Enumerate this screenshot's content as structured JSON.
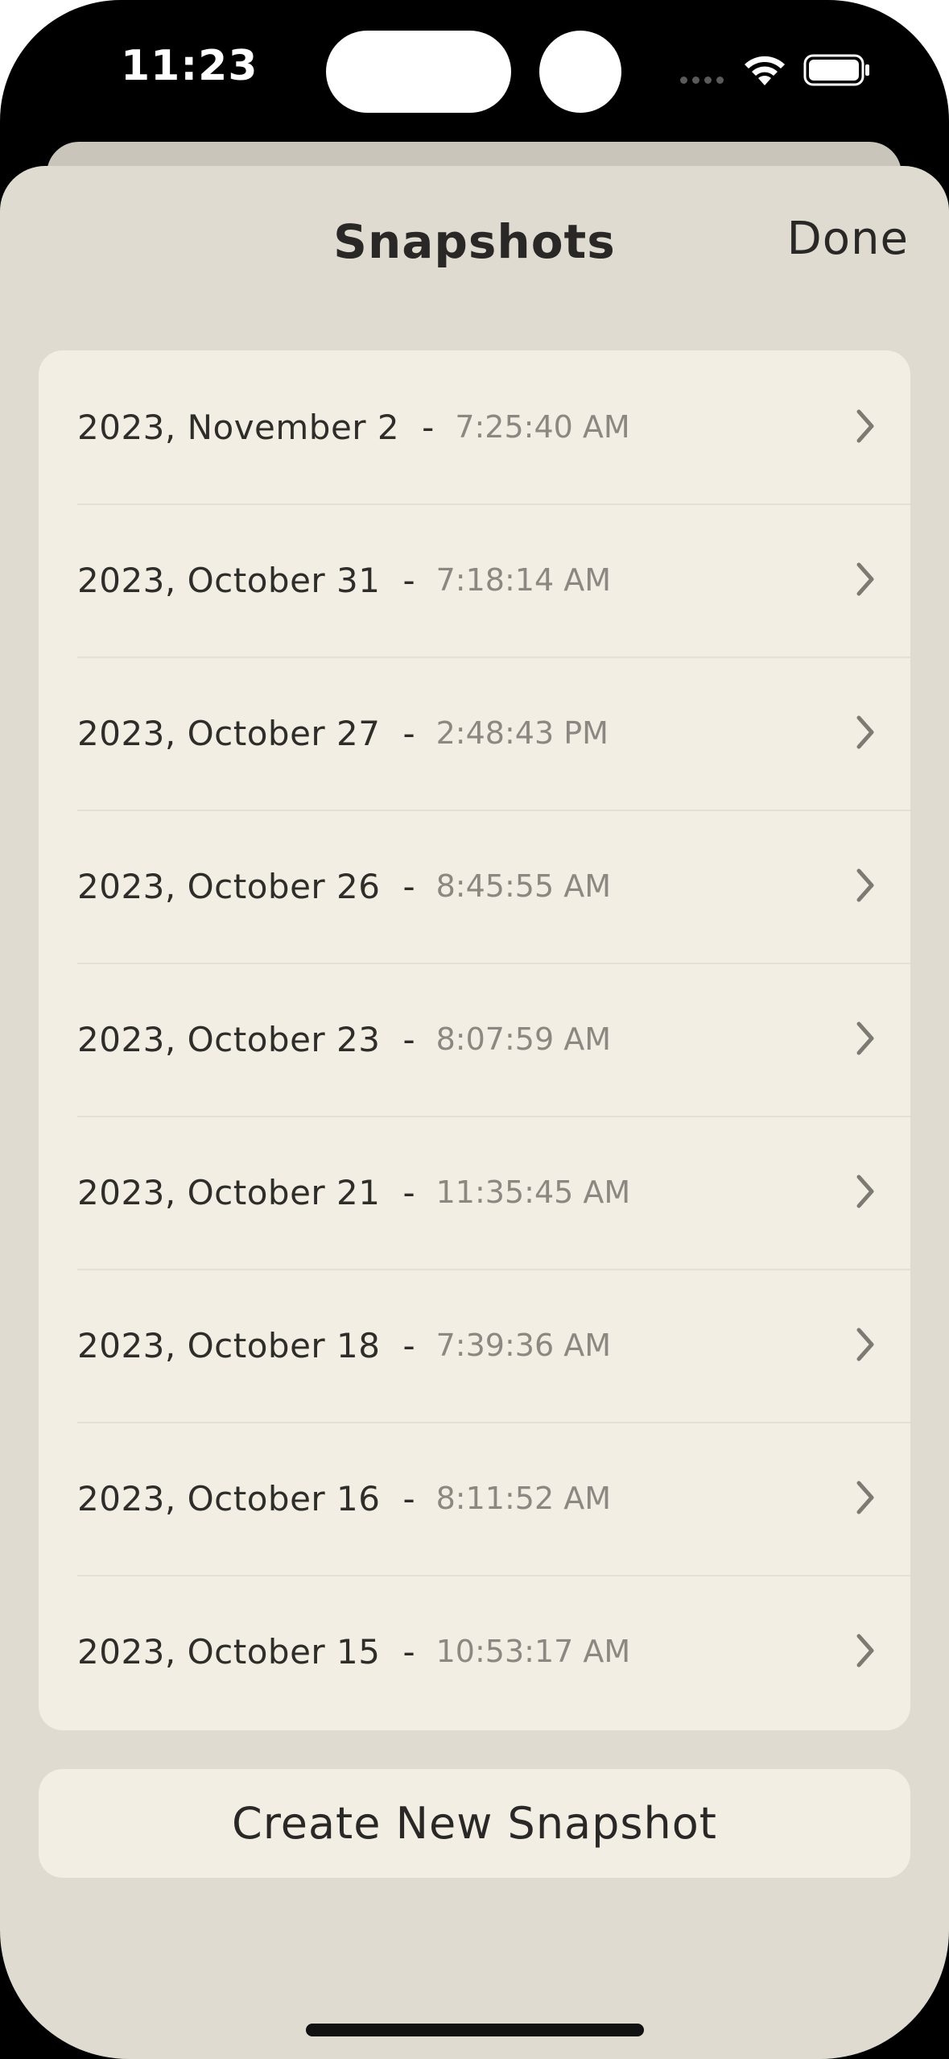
{
  "status_bar": {
    "time": "11:23"
  },
  "sheet": {
    "title": "Snapshots",
    "done_label": "Done"
  },
  "snapshots": [
    {
      "date": "2023, November 2",
      "time": "7:25:40 AM"
    },
    {
      "date": "2023, October 31",
      "time": "7:18:14 AM"
    },
    {
      "date": "2023, October 27",
      "time": "2:48:43 PM"
    },
    {
      "date": "2023, October 26",
      "time": "8:45:55 AM"
    },
    {
      "date": "2023, October 23",
      "time": "8:07:59 AM"
    },
    {
      "date": "2023, October 21",
      "time": "11:35:45 AM"
    },
    {
      "date": "2023, October 18",
      "time": "7:39:36 AM"
    },
    {
      "date": "2023, October 16",
      "time": "8:11:52 AM"
    },
    {
      "date": "2023, October 15",
      "time": "10:53:17 AM"
    }
  ],
  "row_separator": "-",
  "create_button_label": "Create New Snapshot",
  "icons": {
    "row_chevron": "chevron-right-icon",
    "wifi": "wifi-icon",
    "battery": "battery-icon",
    "signal": "cellular-signal-icon"
  },
  "colors": {
    "sheet_background": "#dfdbd1",
    "card_background": "#f2eee4",
    "primary_text": "#2a2826",
    "secondary_text": "#8c8881"
  }
}
